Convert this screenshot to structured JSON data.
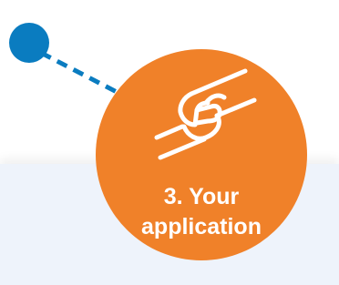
{
  "step": {
    "number_title": "3. Your",
    "subtitle": "application",
    "icon": "handshake-icon"
  },
  "colors": {
    "badge": "#f08129",
    "connector": "#0a7cc0",
    "panel_background": "#eef3fb",
    "text": "#ffffff"
  }
}
